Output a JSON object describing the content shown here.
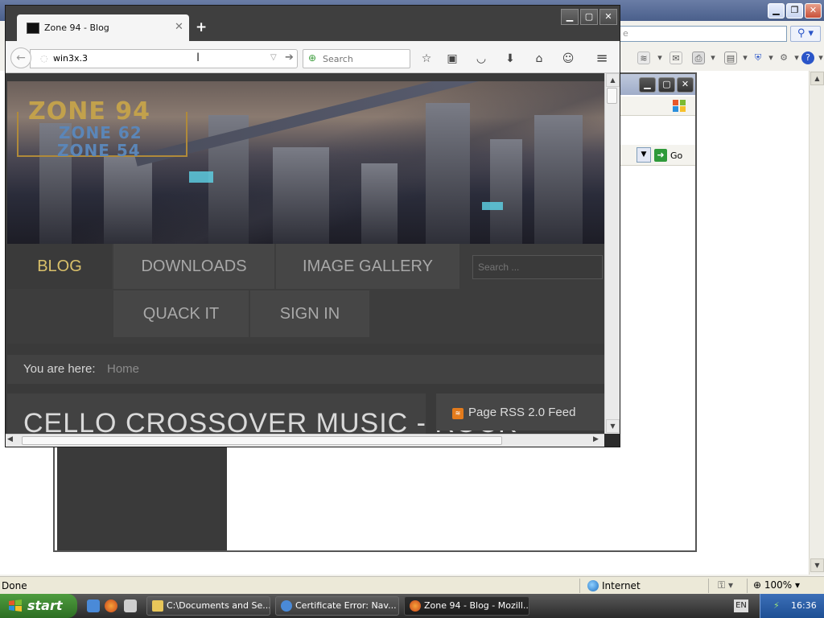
{
  "ie": {
    "address_placeholder": "e",
    "status": "Done",
    "zone": "Internet",
    "zoom": "100%",
    "toolbar_icons": [
      "rss-feed-icon",
      "read-mail-icon",
      "print-icon",
      "page-icon",
      "safety-icon",
      "tools-icon",
      "help-icon"
    ]
  },
  "dialog": {
    "go_label": "Go"
  },
  "firefox": {
    "tab_title": "Zone 94 - Blog",
    "url": "win3x.3",
    "search_placeholder": "Search",
    "toolbar_icons": [
      "bookmark-star-icon",
      "reading-list-icon",
      "pocket-icon",
      "download-icon",
      "home-icon",
      "chat-icon",
      "menu-icon"
    ]
  },
  "blog": {
    "logo_line1": "ZONE 94",
    "logo_line2": "ZONE 62",
    "logo_line3": "ZONE 54",
    "nav": [
      "BLOG",
      "DOWNLOADS",
      "IMAGE GALLERY",
      "QUACK IT",
      "SIGN IN"
    ],
    "active_nav": "BLOG",
    "search_placeholder": "Search ...",
    "breadcrumb_label": "You are here:",
    "breadcrumb_home": "Home",
    "post_title": "CELLO CROSSOVER MUSIC - ROCK",
    "rss_label": "Page RSS 2.0 Feed"
  },
  "taskbar": {
    "start_label": "start",
    "tasks": [
      {
        "label": "C:\\Documents and Se...",
        "icon": "folder-icon",
        "active": false
      },
      {
        "label": "Certificate Error: Nav...",
        "icon": "ie-icon",
        "active": false
      },
      {
        "label": "Zone 94 - Blog - Mozill...",
        "icon": "firefox-icon",
        "active": true
      }
    ],
    "language": "EN",
    "clock": "16:36"
  },
  "colors": {
    "accent_gold": "#d9c06a",
    "nav_bg": "#464646",
    "xp_start_green": "#3f8f30",
    "xp_tray_blue": "#2a5fa8"
  }
}
